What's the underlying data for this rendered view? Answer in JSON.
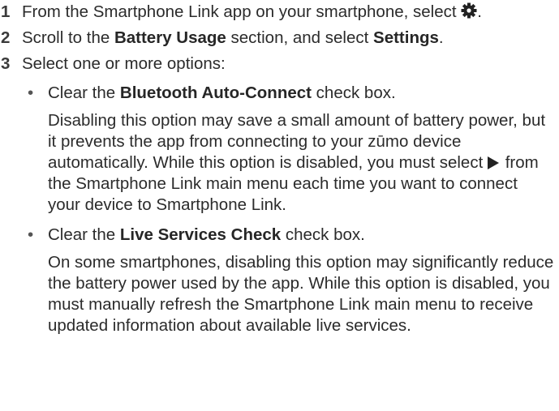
{
  "steps": [
    {
      "num": "1",
      "text_before": "From the Smartphone Link app on your smartphone, select",
      "icon": "gear-icon",
      "text_after": "."
    },
    {
      "num": "2",
      "pre": "Scroll to the ",
      "bold1": "Battery Usage",
      "mid": " section, and select ",
      "bold2": "Settings",
      "post": "."
    },
    {
      "num": "3",
      "text": "Select one or more options:",
      "bullets": [
        {
          "pre": "Clear the ",
          "bold": "Bluetooth Auto-Connect",
          "post": " check box.",
          "note_before": "Disabling this option may save a small amount of battery power, but it prevents the app from connecting to your zūmo device automatically. While this option is disabled, you must select",
          "note_icon": "play-icon",
          "note_after": "from the Smartphone Link main menu each time you want to connect your device to Smartphone Link."
        },
        {
          "pre": "Clear the ",
          "bold": "Live Services Check",
          "post": " check box.",
          "note": "On some smartphones, disabling this option may significantly reduce the battery power used by the app. While this option is disabled, you must manually refresh the Smartphone Link main menu to receive updated information about available live services."
        }
      ]
    }
  ]
}
